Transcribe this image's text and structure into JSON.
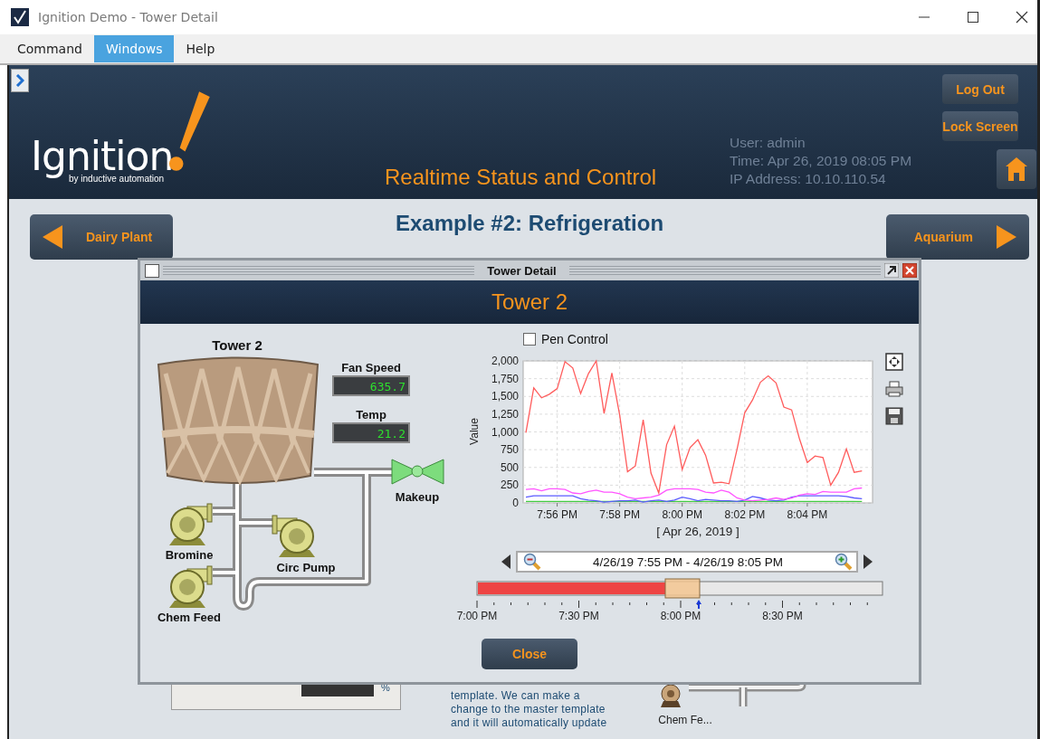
{
  "window": {
    "title": "Ignition Demo - Tower Detail"
  },
  "menu": [
    {
      "label": "Command",
      "selected": false
    },
    {
      "label": "Windows",
      "selected": true
    },
    {
      "label": "Help",
      "selected": false
    }
  ],
  "header": {
    "logo": {
      "wordmark": "Ignition",
      "tagline": "by inductive automation"
    },
    "subtitle": "Realtime Status and Control",
    "info": [
      "User: admin",
      "Time: Apr 26, 2019 08:05 PM",
      "IP Address: 10.10.110.54"
    ],
    "buttons": [
      "Log Out",
      "Lock Screen"
    ]
  },
  "page": {
    "title": "Example #2: Refrigeration",
    "prev": "Dairy Plant",
    "next": "Aquarium"
  },
  "background": {
    "unit": "%",
    "description_lines": [
      "template. We can make a",
      "change to the master template",
      "and it will automatically update"
    ],
    "pump_label": "Chem Fe..."
  },
  "dialog": {
    "title": "Tower Detail",
    "heading": "Tower 2",
    "diagram": {
      "tower_label": "Tower 2",
      "readouts": [
        {
          "label": "Fan Speed",
          "value": "635.7"
        },
        {
          "label": "Temp",
          "value": "21.2"
        }
      ],
      "valve_label": "Makeup",
      "pumps": [
        {
          "label": "Bromine"
        },
        {
          "label": "Circ Pump"
        },
        {
          "label": "Chem Feed"
        }
      ]
    },
    "pen_control": {
      "label": "Pen Control",
      "checked": false
    },
    "chart_data": {
      "type": "line",
      "grid": true,
      "ylabel": "Value",
      "xlabel": "[ Apr 26, 2019 ]",
      "ylim": [
        0,
        2000
      ],
      "categories": [
        null,
        null,
        null,
        null,
        "7:56 PM",
        null,
        null,
        null,
        null,
        null,
        null,
        null,
        "7:58 PM",
        null,
        null,
        null,
        null,
        null,
        null,
        null,
        "8:00 PM",
        null,
        null,
        null,
        null,
        null,
        null,
        null,
        "8:02 PM",
        null,
        null,
        null,
        null,
        null,
        null,
        null,
        "8:04 PM",
        null,
        null,
        null,
        null,
        null,
        null,
        null
      ],
      "yticks": [
        {
          "value": 0,
          "label": "0"
        },
        {
          "value": 250,
          "label": "250"
        },
        {
          "value": 500,
          "label": "500"
        },
        {
          "value": 750,
          "label": "750"
        },
        {
          "value": 1000,
          "label": "1,000"
        },
        {
          "value": 1250,
          "label": "1,250"
        },
        {
          "value": 1500,
          "label": "1,500"
        },
        {
          "value": 1750,
          "label": "1,750"
        },
        {
          "value": 2000,
          "label": "2,000"
        }
      ],
      "series": [
        {
          "color": "#ff5c5c",
          "values": [
            990,
            1620,
            1480,
            1530,
            1610,
            1990,
            1900,
            1540,
            1820,
            2000,
            1260,
            1830,
            1240,
            440,
            520,
            1170,
            420,
            140,
            820,
            1080,
            470,
            780,
            890,
            670,
            280,
            290,
            270,
            750,
            1270,
            1450,
            1700,
            1790,
            1690,
            1350,
            1310,
            900,
            570,
            660,
            640,
            250,
            430,
            760,
            430,
            450
          ]
        },
        {
          "color": "#ff55ff",
          "values": [
            190,
            200,
            170,
            200,
            200,
            190,
            140,
            130,
            160,
            180,
            150,
            150,
            130,
            80,
            60,
            70,
            80,
            110,
            180,
            200,
            200,
            200,
            190,
            150,
            140,
            180,
            150,
            70,
            40,
            30,
            40,
            50,
            70,
            50,
            70,
            110,
            130,
            120,
            160,
            150,
            150,
            150,
            200,
            210
          ]
        },
        {
          "color": "#5b5bff",
          "values": [
            80,
            100,
            100,
            100,
            100,
            100,
            100,
            60,
            40,
            30,
            10,
            20,
            30,
            30,
            40,
            10,
            30,
            40,
            20,
            40,
            80,
            60,
            30,
            50,
            40,
            30,
            30,
            20,
            40,
            90,
            70,
            40,
            30,
            40,
            80,
            100,
            100,
            100,
            100,
            100,
            100,
            90,
            70,
            60
          ]
        },
        {
          "color": "#44cc44",
          "values": [
            20,
            20,
            20,
            20,
            20,
            20,
            20,
            20,
            20,
            20,
            20,
            20,
            20,
            20,
            20,
            20,
            20,
            20,
            20,
            20,
            20,
            20,
            20,
            20,
            20,
            20,
            20,
            20,
            20,
            20,
            20,
            20,
            20,
            20,
            20,
            20,
            20,
            20,
            20,
            20,
            20,
            20,
            20,
            20
          ]
        }
      ]
    },
    "range": "4/26/19 7:55 PM - 4/26/19 8:05 PM",
    "timeline_ticks": [
      "7:00 PM",
      "7:30 PM",
      "8:00 PM",
      "8:30 PM"
    ],
    "close": "Close"
  }
}
